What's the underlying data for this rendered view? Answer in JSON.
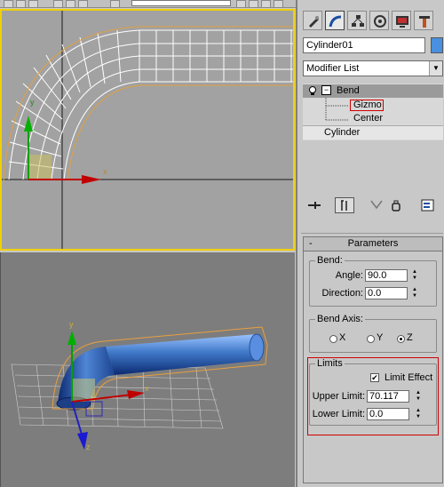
{
  "viewports": {
    "top": {
      "axis_x": "x",
      "axis_y": "y"
    },
    "perspective": {
      "axis_x": "x",
      "axis_y": "y",
      "axis_z": "z"
    }
  },
  "command_panel": {
    "tabs": [
      "create-icon",
      "modify-icon",
      "hierarchy-icon",
      "motion-icon",
      "display-icon",
      "utilities-icon"
    ],
    "object_name": "Cylinder01",
    "object_color": "#4a90e0",
    "modifier_list_label": "Modifier List",
    "stack": {
      "bend_label": "Bend",
      "gizmo_label": "Gizmo",
      "center_label": "Center",
      "base_label": "Cylinder"
    },
    "parameters": {
      "title": "Parameters",
      "collapse_glyph": "-",
      "bend_group": "Bend:",
      "angle_label": "Angle:",
      "angle_value": "90.0",
      "direction_label": "Direction:",
      "direction_value": "0.0",
      "bend_axis_group": "Bend Axis:",
      "axis_x": "X",
      "axis_y": "Y",
      "axis_z": "Z",
      "selected_axis": "Z",
      "limits_group": "Limits",
      "limit_effect_label": "Limit Effect",
      "limit_effect_checked": true,
      "upper_limit_label": "Upper Limit:",
      "upper_limit_value": "70.117",
      "lower_limit_label": "Lower Limit:",
      "lower_limit_value": "0.0"
    }
  },
  "colors": {
    "active_viewport_border": "#f0d000",
    "highlight_red": "#d00000",
    "mesh_blue": "#3f78c8"
  }
}
